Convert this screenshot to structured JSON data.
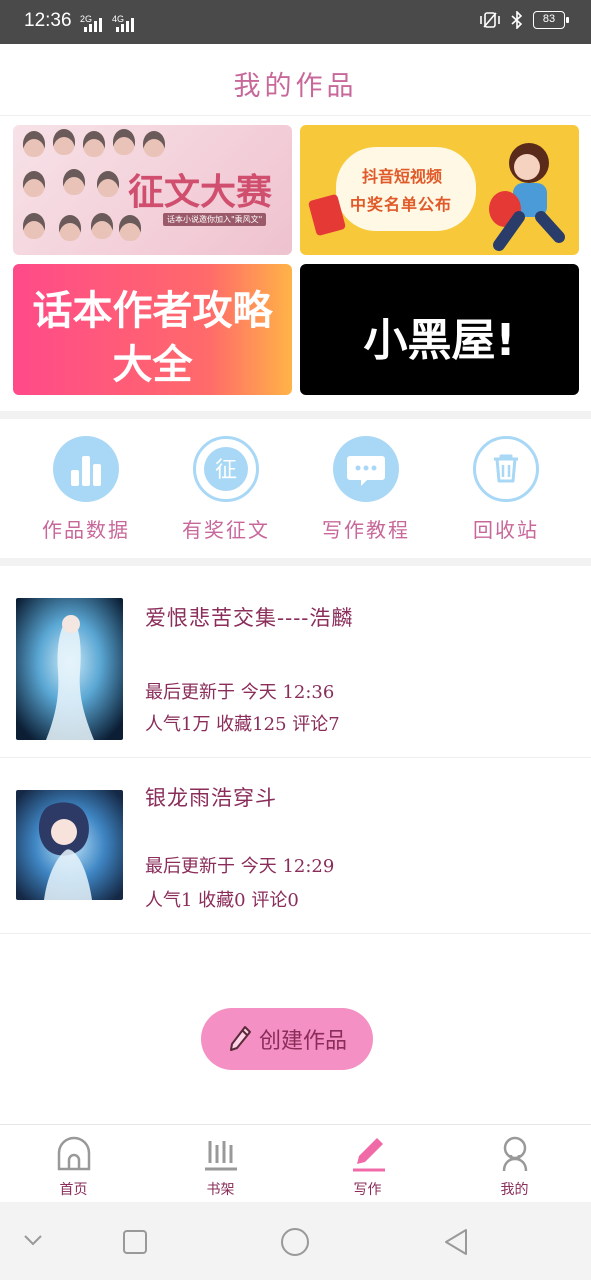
{
  "status": {
    "time": "12:36",
    "sig1": "2G",
    "sig2": "4G",
    "battery": "83"
  },
  "header": {
    "title": "我的作品"
  },
  "banners": {
    "contest": {
      "title": "征文大赛",
      "subtitle": "话本小说邀你加入\"乘风文\""
    },
    "douyin": {
      "line1": "抖音短视频",
      "line2": "中奖名单公布"
    },
    "guide": {
      "line1": "话本作者攻略",
      "line2": "大全"
    },
    "blackroom": {
      "text": "小黑屋!"
    }
  },
  "quick": [
    {
      "label": "作品数据",
      "icon": "bar-chart-icon"
    },
    {
      "label": "有奖征文",
      "icon": "contest-icon",
      "glyph": "征"
    },
    {
      "label": "写作教程",
      "icon": "chat-bubble-icon"
    },
    {
      "label": "回收站",
      "icon": "trash-icon"
    }
  ],
  "works": [
    {
      "title": "爱恨悲苦交集----浩麟",
      "updated": "最后更新于 今天 12:36",
      "stats": "人气1万 收藏125 评论7"
    },
    {
      "title": "银龙雨浩穿斗",
      "updated": "最后更新于 今天 12:29",
      "stats": "人气1 收藏0 评论0"
    }
  ],
  "create_label": "创建作品",
  "tabs": [
    {
      "label": "首页",
      "icon": "home-icon"
    },
    {
      "label": "书架",
      "icon": "bookshelf-icon"
    },
    {
      "label": "写作",
      "icon": "pen-icon"
    },
    {
      "label": "我的",
      "icon": "profile-icon"
    }
  ],
  "colors": {
    "accent": "#c8689a",
    "dark_accent": "#8a2d5a",
    "icon_blue": "#a8d8f6",
    "button_pink": "#f590c4"
  }
}
